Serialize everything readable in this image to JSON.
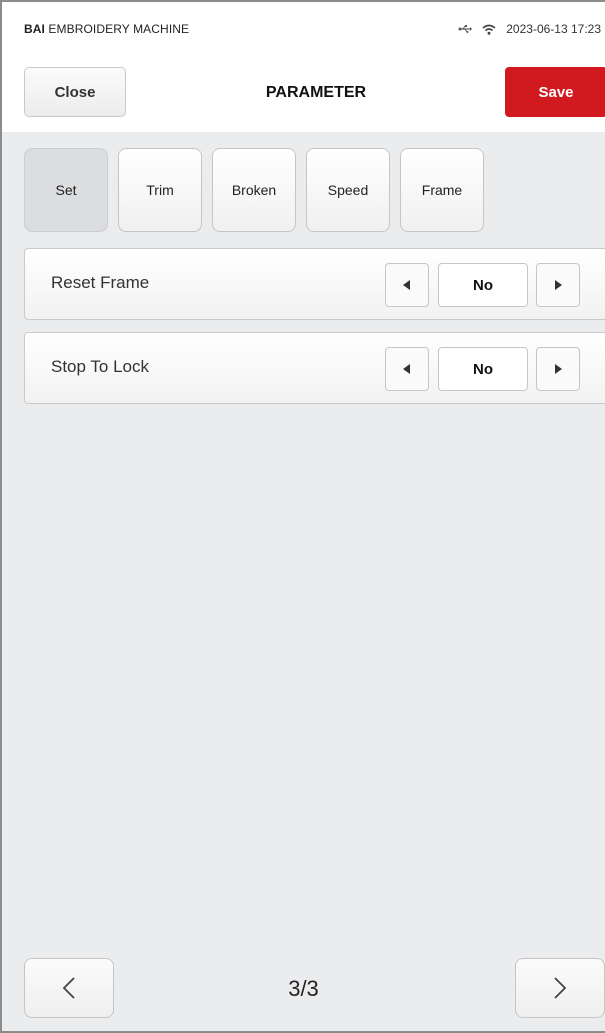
{
  "status_bar": {
    "brand_bold": "BAI",
    "brand_rest": " EMBROIDERY MACHINE",
    "usb_icon": "usb-icon",
    "wifi_icon": "wifi-icon",
    "datetime": "2023-06-13 17:23"
  },
  "header": {
    "close_label": "Close",
    "title": "PARAMETER",
    "save_label": "Save",
    "save_color": "#d11a1f"
  },
  "tabs": [
    {
      "label": "Set",
      "active": true
    },
    {
      "label": "Trim",
      "active": false
    },
    {
      "label": "Broken",
      "active": false
    },
    {
      "label": "Speed",
      "active": false
    },
    {
      "label": "Frame",
      "active": false
    }
  ],
  "params": [
    {
      "label": "Reset Frame",
      "value": "No"
    },
    {
      "label": "Stop To Lock",
      "value": "No"
    }
  ],
  "pager": {
    "indicator": "3/3",
    "prev_icon": "chevron-left-icon",
    "next_icon": "chevron-right-icon"
  }
}
